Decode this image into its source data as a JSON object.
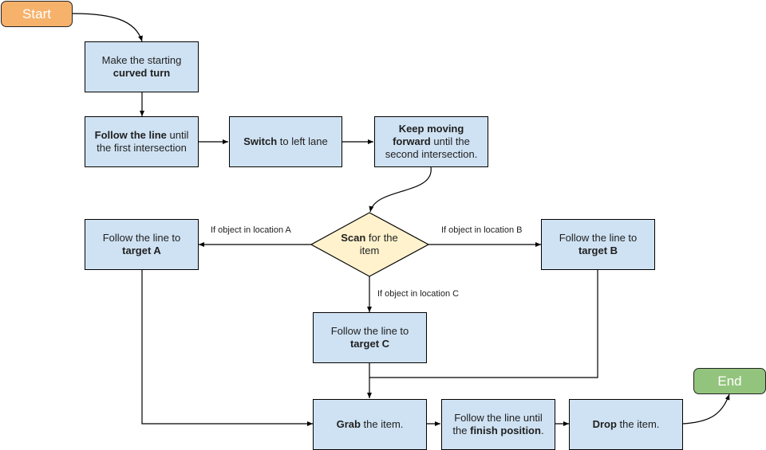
{
  "colors": {
    "process_fill": "#cfe2f3",
    "decision_fill": "#fff2cc",
    "start_fill": "#f6b26b",
    "end_fill": "#93c47d",
    "edge": "#000000"
  },
  "nodes": {
    "start": {
      "label": "Start"
    },
    "end": {
      "label": "End"
    },
    "curved_turn": {
      "pre": "Make the starting ",
      "bold": "curved turn",
      "post": ""
    },
    "follow_first": {
      "bold": "Follow the line",
      "post": " until the first intersection"
    },
    "switch_lane": {
      "bold": "Switch",
      "post": " to left lane"
    },
    "keep_moving": {
      "bold": "Keep moving forward",
      "post": " until the second intersection."
    },
    "scan": {
      "bold": "Scan",
      "post": " for the item"
    },
    "target_a": {
      "pre": "Follow the line to ",
      "bold": "target A"
    },
    "target_b": {
      "pre": "Follow the line to ",
      "bold": "target B"
    },
    "target_c": {
      "pre": "Follow the line to ",
      "bold": "target C"
    },
    "grab": {
      "bold": "Grab",
      "post": " the item."
    },
    "finish": {
      "pre": "Follow the line until the ",
      "bold": "finish position",
      "post": "."
    },
    "drop": {
      "bold": "Drop",
      "post": " the item."
    }
  },
  "edge_labels": {
    "to_a": "If object in location A",
    "to_b": "If object in location B",
    "to_c": "If object in location C"
  }
}
